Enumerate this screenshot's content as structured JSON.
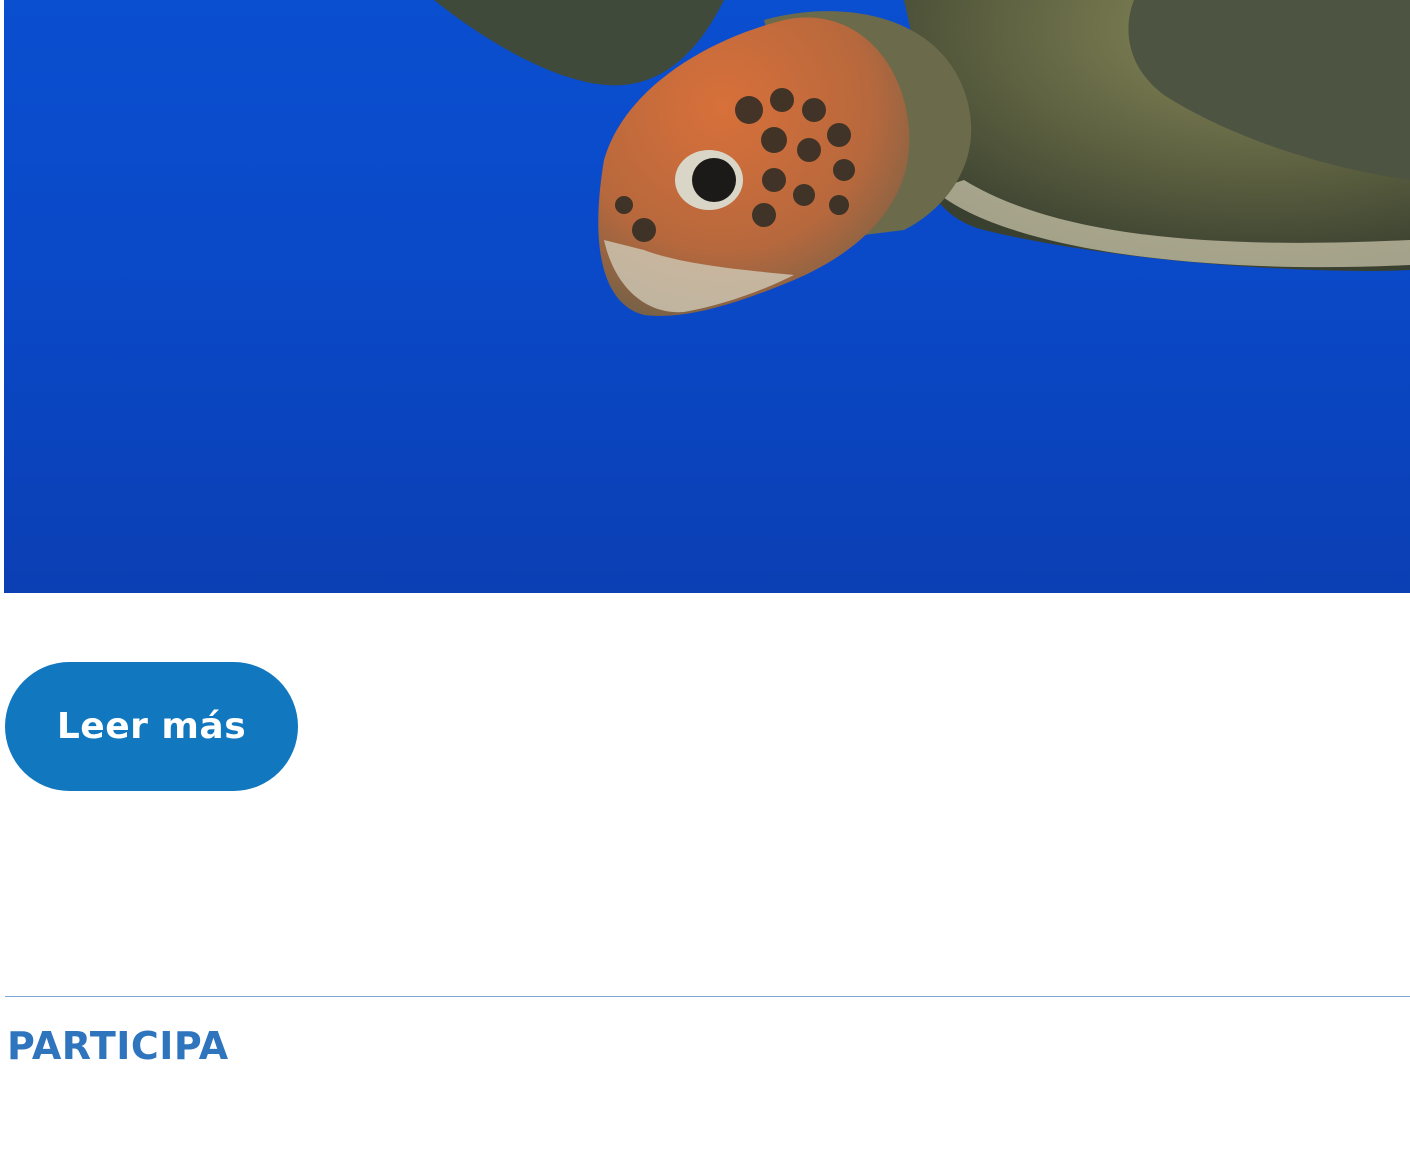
{
  "hero": {
    "image_alt_icon": "sea-turtle-photo"
  },
  "cta": {
    "read_more_label": "Leer más"
  },
  "section": {
    "title": "PARTICIPA"
  },
  "colors": {
    "ocean_blue": "#0a49c8",
    "button_blue": "#1177be",
    "title_blue": "#2e75be",
    "divider_blue": "#7aa3d6"
  }
}
